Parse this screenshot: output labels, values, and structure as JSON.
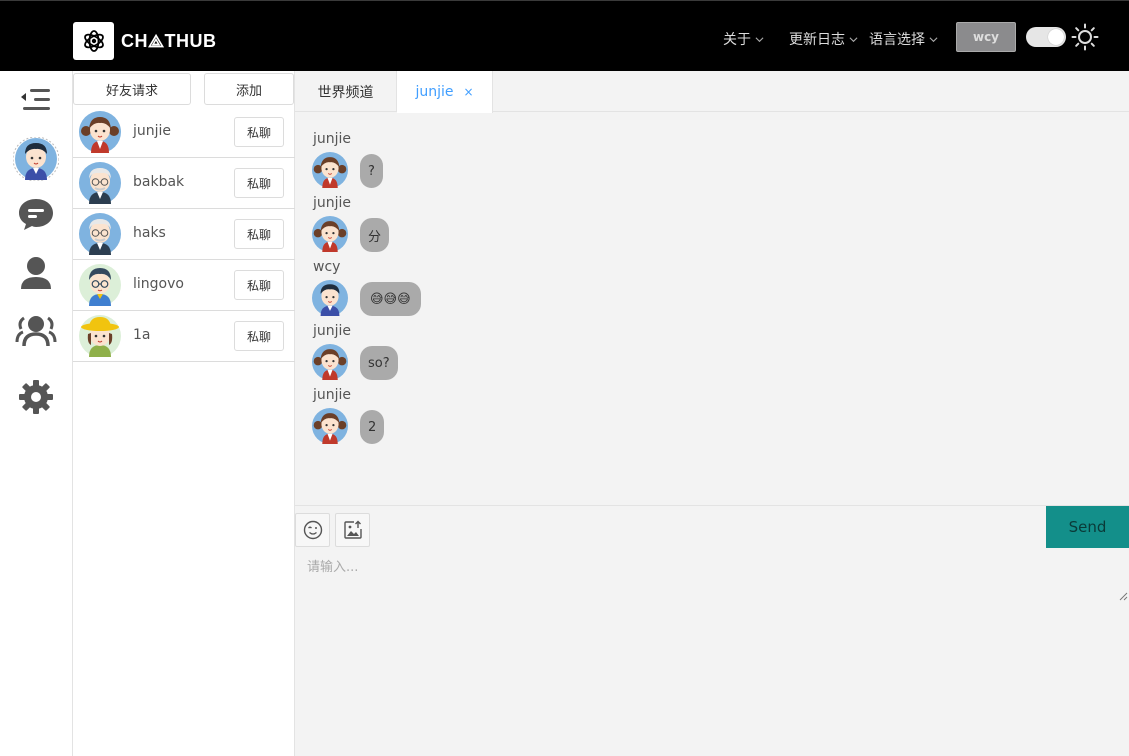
{
  "header": {
    "logo_text": "CH⟁THUB",
    "menu_about": "关于",
    "menu_changelog": "更新日志",
    "menu_language": "语言选择",
    "user_button": "wcy",
    "theme_toggle_on": true
  },
  "sidebar": {
    "icons": [
      "collapse-menu-icon",
      "user-avatar",
      "chat-bubble-icon",
      "contact-person-icon",
      "group-icon",
      "settings-gear-icon"
    ]
  },
  "friend_panel": {
    "friend_requests_label": "好友请求",
    "add_label": "添加",
    "private_chat_label": "私聊",
    "friends": [
      {
        "name": "junjie",
        "avatar": "girl-pigtails"
      },
      {
        "name": "bakbak",
        "avatar": "old-man-glasses"
      },
      {
        "name": "haks",
        "avatar": "old-man-glasses"
      },
      {
        "name": "lingovo",
        "avatar": "boy-glasses"
      },
      {
        "name": "1a",
        "avatar": "girl-yellow-hat"
      }
    ]
  },
  "tabs": {
    "world_channel": "世界频道",
    "active_chat": "junjie",
    "close_symbol": "×"
  },
  "messages": [
    {
      "sender": "junjie",
      "text": "?",
      "avatar": "girl-pigtails"
    },
    {
      "sender": "junjie",
      "text": "分",
      "avatar": "girl-pigtails"
    },
    {
      "sender": "wcy",
      "text": "😅😅😅",
      "avatar": "boy"
    },
    {
      "sender": "junjie",
      "text": "so?",
      "avatar": "girl-pigtails"
    },
    {
      "sender": "junjie",
      "text": "2",
      "avatar": "girl-pigtails"
    }
  ],
  "composer": {
    "placeholder": "请输入...",
    "send_label": "Send"
  },
  "colors": {
    "header_bg": "#000000",
    "accent_tab": "#409eff",
    "send_bg": "#138f8a",
    "bubble_bg": "#aaaaaa"
  }
}
